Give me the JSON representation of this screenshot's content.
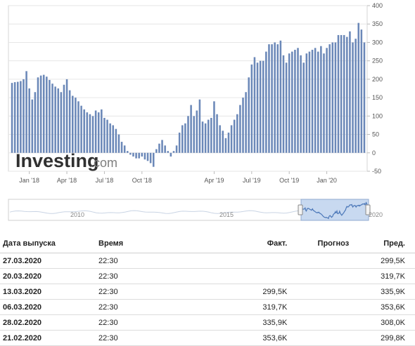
{
  "chart_data": {
    "type": "bar",
    "ylim": [
      -50,
      400
    ],
    "yticks": [
      400,
      350,
      300,
      250,
      200,
      150,
      100,
      50,
      0,
      -50
    ],
    "xticks": [
      {
        "label": "Jan '18",
        "index": 6
      },
      {
        "label": "Apr '18",
        "index": 19
      },
      {
        "label": "Jul '18",
        "index": 32
      },
      {
        "label": "Oct '18",
        "index": 45
      },
      {
        "label": "Apr '19",
        "index": 70
      },
      {
        "label": "Jul '19",
        "index": 83
      },
      {
        "label": "Oct '19",
        "index": 96
      },
      {
        "label": "Jan '20",
        "index": 109
      }
    ],
    "bar_color": "#6b88b8",
    "values": [
      190,
      192,
      193,
      195,
      200,
      222,
      175,
      145,
      165,
      205,
      210,
      212,
      207,
      198,
      188,
      180,
      175,
      165,
      185,
      200,
      170,
      155,
      150,
      140,
      128,
      118,
      110,
      105,
      100,
      115,
      110,
      118,
      95,
      90,
      80,
      75,
      65,
      50,
      30,
      20,
      5,
      -5,
      -10,
      -15,
      -15,
      -10,
      -18,
      -22,
      -28,
      -38,
      10,
      25,
      35,
      20,
      5,
      -10,
      5,
      20,
      55,
      75,
      80,
      100,
      130,
      100,
      115,
      145,
      85,
      80,
      90,
      95,
      140,
      105,
      75,
      60,
      40,
      55,
      75,
      90,
      105,
      130,
      150,
      165,
      205,
      240,
      260,
      245,
      250,
      250,
      275,
      295,
      295,
      300,
      295,
      305,
      265,
      245,
      270,
      275,
      280,
      285,
      265,
      245,
      270,
      275,
      280,
      285,
      275,
      290,
      270,
      285,
      295,
      300,
      300,
      320,
      320,
      320,
      315,
      330,
      300,
      310,
      353,
      335,
      300
    ],
    "navigator": {
      "labels": [
        "2010",
        "2015",
        "2020"
      ]
    }
  },
  "watermark": {
    "brand": "Investing",
    "suffix": ".com"
  },
  "table": {
    "headers": {
      "date": "Дата выпуска",
      "time": "Время",
      "actual": "Факт.",
      "forecast": "Прогноз",
      "previous": "Пред."
    },
    "rows": [
      {
        "date": "27.03.2020",
        "time": "22:30",
        "actual": "",
        "forecast": "",
        "previous": "299,5K"
      },
      {
        "date": "20.03.2020",
        "time": "22:30",
        "actual": "",
        "forecast": "",
        "previous": "319,7K"
      },
      {
        "date": "13.03.2020",
        "time": "22:30",
        "actual": "299,5K",
        "forecast": "",
        "previous": "335,9K"
      },
      {
        "date": "06.03.2020",
        "time": "22:30",
        "actual": "319,7K",
        "forecast": "",
        "previous": "353,6K"
      },
      {
        "date": "28.02.2020",
        "time": "22:30",
        "actual": "335,9K",
        "forecast": "",
        "previous": "308,0K"
      },
      {
        "date": "21.02.2020",
        "time": "22:30",
        "actual": "353,6K",
        "forecast": "",
        "previous": "299,8K"
      }
    ]
  }
}
